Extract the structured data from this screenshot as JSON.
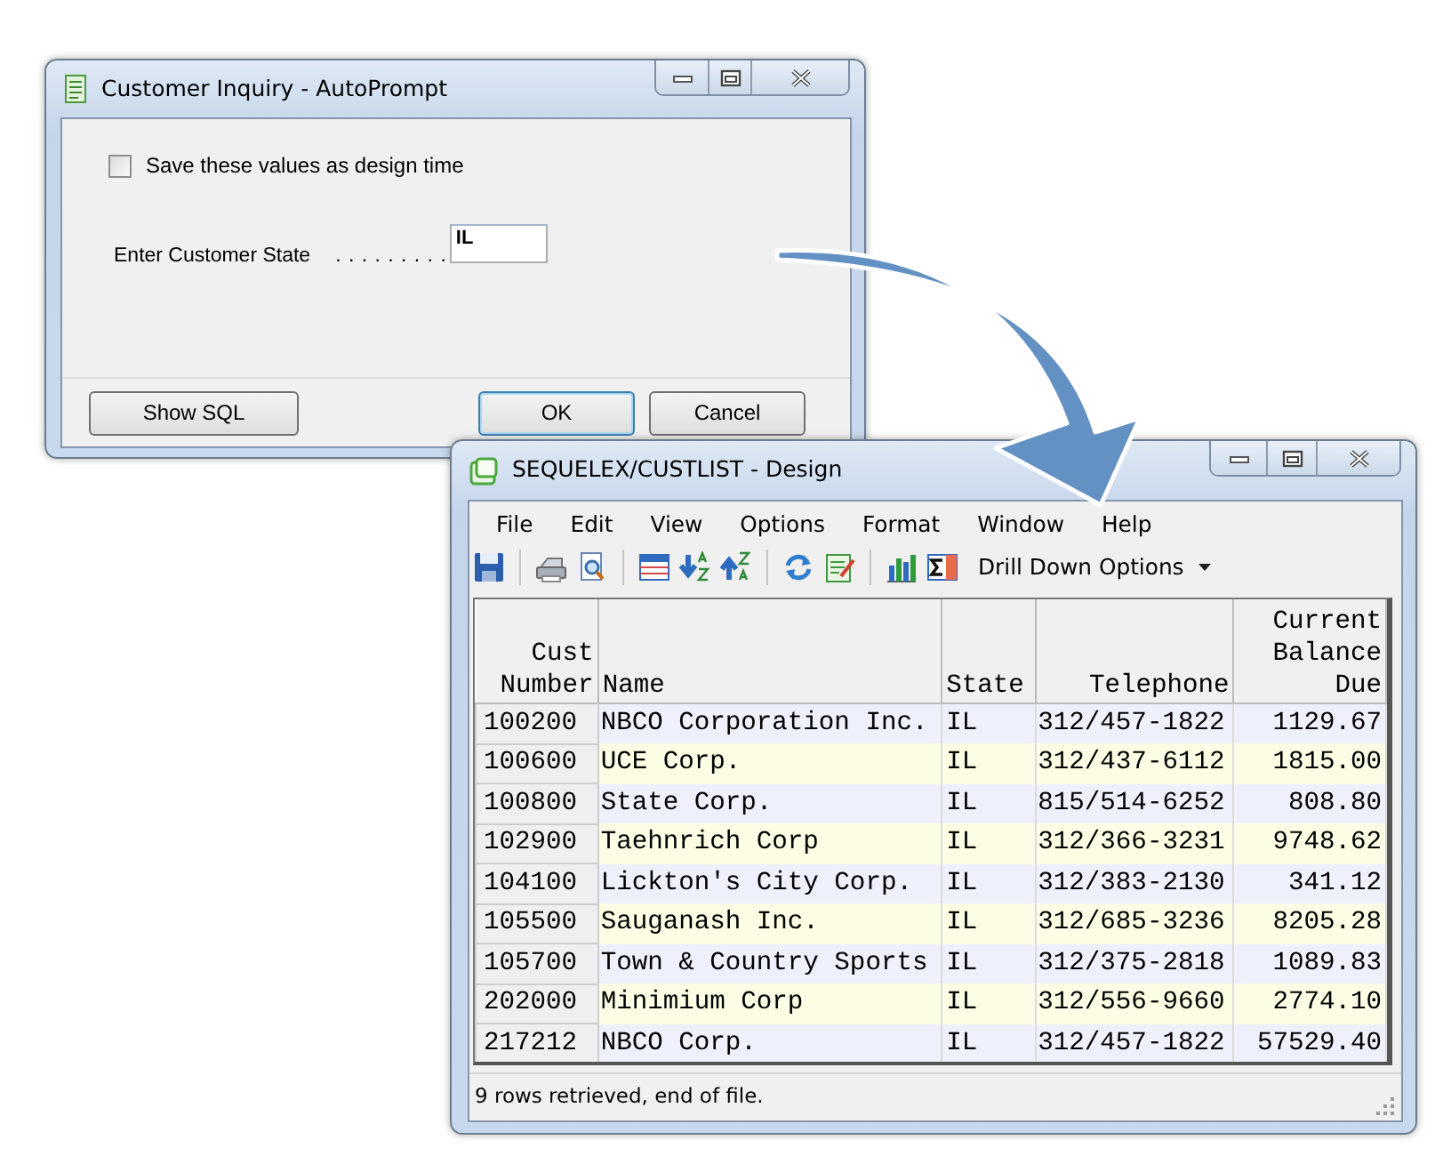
{
  "dialog": {
    "title": "Customer Inquiry - AutoPrompt",
    "checkbox": {
      "label": "Save these values as design time",
      "checked": false
    },
    "field": {
      "label": "Enter Customer State",
      "leader": ". . . . . . . . .",
      "value": "IL"
    },
    "buttons": [
      {
        "label": "Show SQL",
        "default": false
      },
      {
        "label": "OK",
        "default": true
      },
      {
        "label": "Cancel",
        "default": false
      }
    ]
  },
  "window": {
    "title": "SEQUELEX/CUSTLIST - Design",
    "menu": [
      "File",
      "Edit",
      "View",
      "Options",
      "Format",
      "Window",
      "Help"
    ],
    "toolbar": {
      "dropdown": "Drill Down Options"
    },
    "table": {
      "columns": [
        "Cust\nNumber",
        "Name",
        "State",
        "Telephone",
        "Current\nBalance\nDue"
      ],
      "rows": [
        [
          "100200",
          "NBCO Corporation Inc.",
          "IL",
          "312/457-1822",
          "1129.67"
        ],
        [
          "100600",
          "UCE Corp.",
          "IL",
          "312/437-6112",
          "1815.00"
        ],
        [
          "100800",
          "State Corp.",
          "IL",
          "815/514-6252",
          "808.80"
        ],
        [
          "102900",
          "Taehnrich Corp",
          "IL",
          "312/366-3231",
          "9748.62"
        ],
        [
          "104100",
          "Lickton's City Corp.",
          "IL",
          "312/383-2130",
          "341.12"
        ],
        [
          "105500",
          "Sauganash Inc.",
          "IL",
          "312/685-3236",
          "8205.28"
        ],
        [
          "105700",
          "Town & Country Sports",
          "IL",
          "312/375-2818",
          "1089.83"
        ],
        [
          "202000",
          "Minimium Corp",
          "IL",
          "312/556-9660",
          "2774.10"
        ],
        [
          "217212",
          "NBCO Corp.",
          "IL",
          "312/457-1822",
          "57529.40"
        ]
      ]
    },
    "status_bar": "9 rows retrieved, end of file."
  }
}
